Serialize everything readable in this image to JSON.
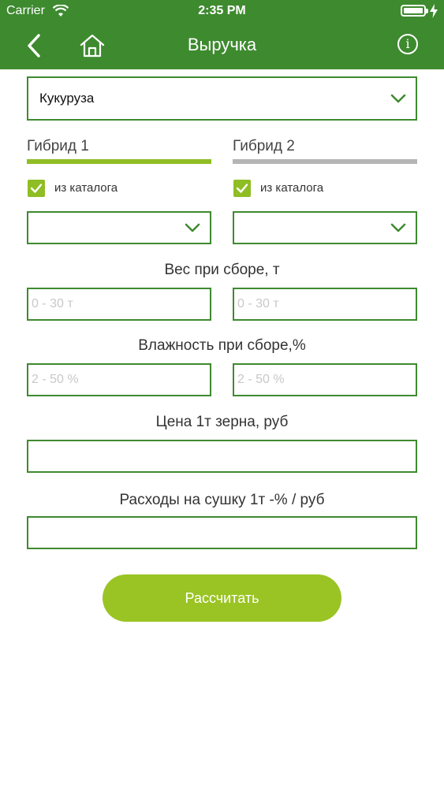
{
  "status_bar": {
    "carrier": "Carrier",
    "time": "2:35 PM"
  },
  "nav": {
    "title": "Выручка"
  },
  "crop_select": {
    "value": "Кукуруза"
  },
  "hybrids": [
    {
      "label": "Гибрид 1",
      "active": true,
      "catalog_label": "из каталога",
      "catalog_checked": true,
      "select_value": ""
    },
    {
      "label": "Гибрид 2",
      "active": false,
      "catalog_label": "из каталога",
      "catalog_checked": true,
      "select_value": ""
    }
  ],
  "weight": {
    "label": "Вес при сборе, т",
    "placeholder_1": "0 - 30 т",
    "placeholder_2": "0 - 30 т"
  },
  "moisture": {
    "label": "Влажность при сборе,%",
    "placeholder_1": "2 - 50 %",
    "placeholder_2": "2 - 50 %"
  },
  "price": {
    "label": "Цена 1т зерна, руб",
    "value": ""
  },
  "drying": {
    "label": "Расходы на сушку 1т -% / руб",
    "value": ""
  },
  "actions": {
    "calculate_label": "Рассчитать"
  },
  "colors": {
    "header_green": "#3e8a2f",
    "accent_green": "#8fbd24",
    "button_green": "#9ac423",
    "inactive_tab": "#b5b5b5"
  }
}
